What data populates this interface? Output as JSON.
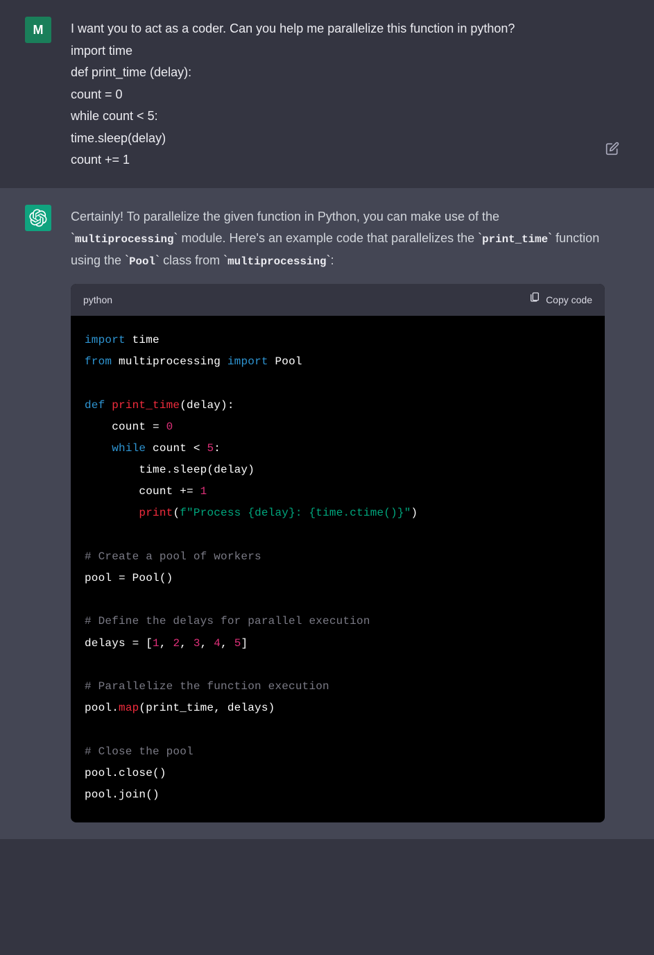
{
  "user": {
    "avatar_letter": "M",
    "message": "I want you to act as a coder. Can you help me parallelize this function in python?\nimport time\ndef print_time (delay):\ncount = 0\nwhile count < 5:\ntime.sleep(delay)\ncount += 1"
  },
  "assistant": {
    "intro_text_1": "Certainly! To parallelize the given function in Python, you can make use of the ",
    "intro_code_1": "multiprocessing",
    "intro_text_2": " module. Here's an example code that parallelizes the ",
    "intro_code_2": "print_time",
    "intro_text_3": " function using the ",
    "intro_code_3": "Pool",
    "intro_text_4": " class from ",
    "intro_code_4": "multiprocessing",
    "intro_text_5": ":"
  },
  "code_block": {
    "language": "python",
    "copy_label": "Copy code",
    "tokens": {
      "import1": "import",
      "time1": " time",
      "from1": "from",
      "mp": " multiprocessing ",
      "import2": "import",
      "pool1": " Pool",
      "def1": "def",
      "sp1": " ",
      "fnname": "print_time",
      "sig": "(delay):",
      "indent1": "    count = ",
      "zero": "0",
      "indent2": "    ",
      "while1": "while",
      "whilecond": " count < ",
      "five": "5",
      "colon1": ":",
      "sleep": "        time.sleep(delay)",
      "countinc": "        count += ",
      "one": "1",
      "printindent": "        ",
      "printfn": "print",
      "lparen": "(",
      "fprefix": "f\"Process ",
      "fexpr1": "{delay}",
      "fmid": ": ",
      "fexpr2": "{time.ctime()}",
      "fend": "\"",
      "rparen": ")",
      "cmt1": "# Create a pool of workers",
      "poolassign": "pool = Pool()",
      "cmt2": "# Define the delays for parallel execution",
      "delays_pre": "delays = [",
      "n1": "1",
      "c": ", ",
      "n2": "2",
      "n3": "3",
      "n4": "4",
      "n5": "5",
      "delays_post": "]",
      "cmt3": "# Parallelize the function execution",
      "pooldot": "pool.",
      "mapfn": "map",
      "mapargs": "(print_time, delays)",
      "cmt4": "# Close the pool",
      "close": "pool.close()",
      "join": "pool.join()"
    }
  }
}
